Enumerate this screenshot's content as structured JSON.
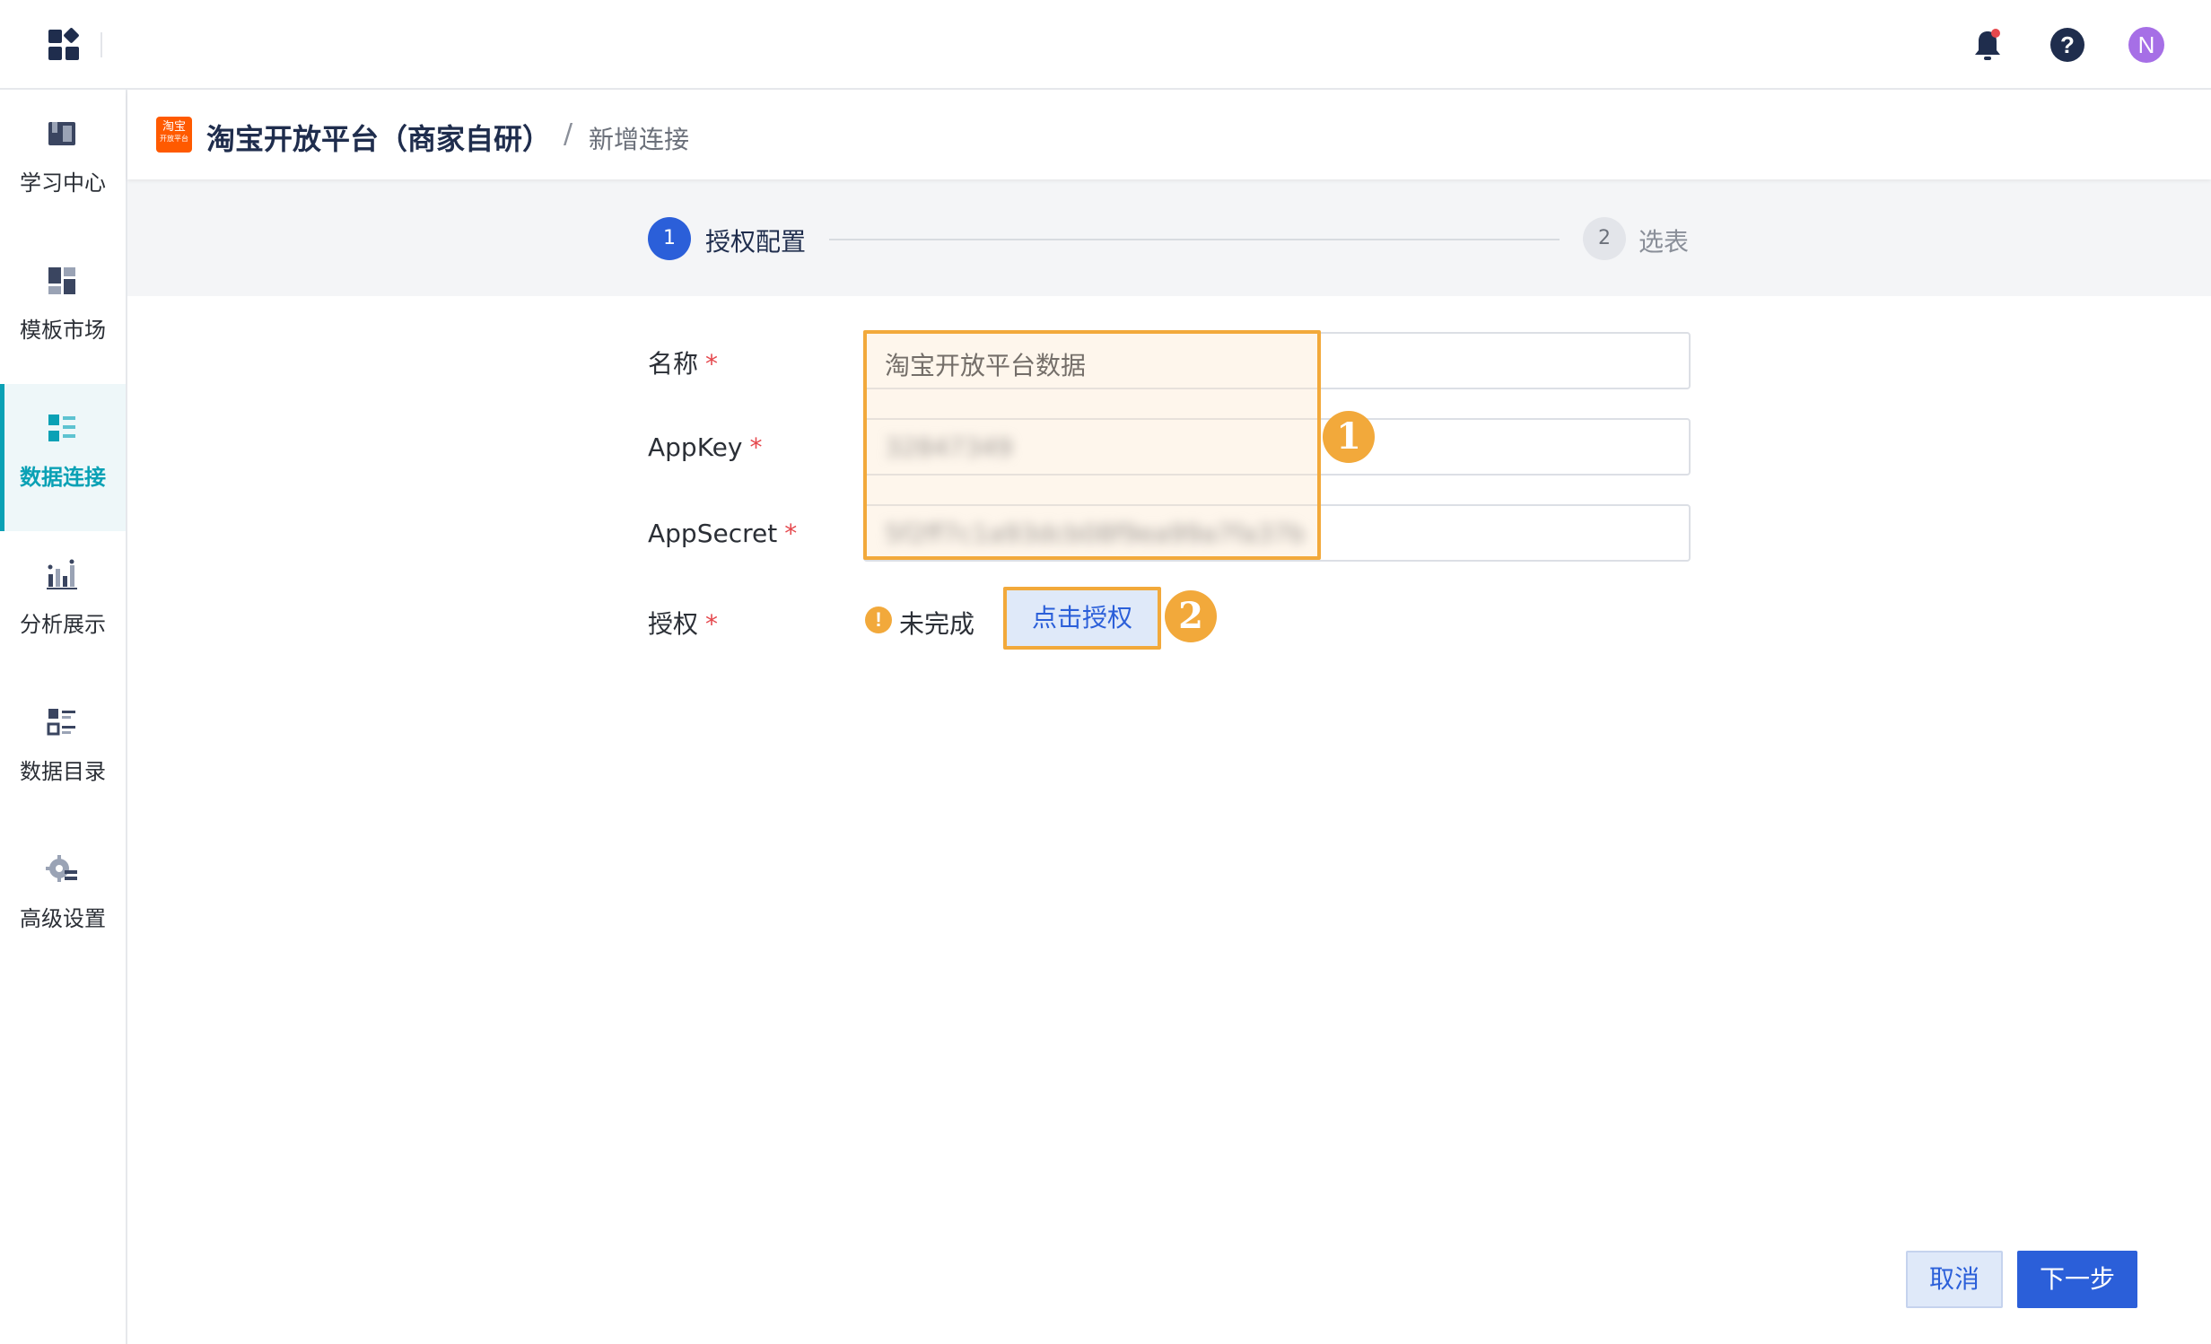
{
  "sidebar": {
    "items": [
      {
        "label": "学习中心",
        "icon": "book-icon"
      },
      {
        "label": "模板市场",
        "icon": "template-icon"
      },
      {
        "label": "数据连接",
        "icon": "data-connection-icon"
      },
      {
        "label": "分析展示",
        "icon": "chart-icon"
      },
      {
        "label": "数据目录",
        "icon": "catalog-icon"
      },
      {
        "label": "高级设置",
        "icon": "settings-icon"
      }
    ],
    "active_index": 2,
    "active_color": "#0aa1b5"
  },
  "topbar": {
    "avatar_initial": "N",
    "help_glyph": "?"
  },
  "header": {
    "logo_top": "淘宝",
    "logo_bottom": "开放平台",
    "title": "淘宝开放平台（商家自研）",
    "separator": "/",
    "breadcrumb": "新增连接"
  },
  "steps": [
    {
      "number": "1",
      "label": "授权配置",
      "active": true
    },
    {
      "number": "2",
      "label": "选表",
      "active": false
    }
  ],
  "form": {
    "name_label": "名称",
    "name_value": "淘宝开放平台数据",
    "appkey_label": "AppKey",
    "appkey_value": "32847349",
    "appsecret_label": "AppSecret",
    "appsecret_value": "5f2ff7c1a93dcb08f9ea99a7fa37b",
    "auth_label": "授权",
    "required_mark": "*",
    "auth_status": "未完成",
    "auth_status_icon": "!",
    "auth_button": "点击授权"
  },
  "annotations": {
    "badge1": "1",
    "badge2": "2",
    "color": "#f2a93b"
  },
  "footer": {
    "cancel": "取消",
    "next": "下一步"
  },
  "colors": {
    "primary": "#2b5fd9",
    "warning": "#f2a93b",
    "required": "#e5484d"
  }
}
